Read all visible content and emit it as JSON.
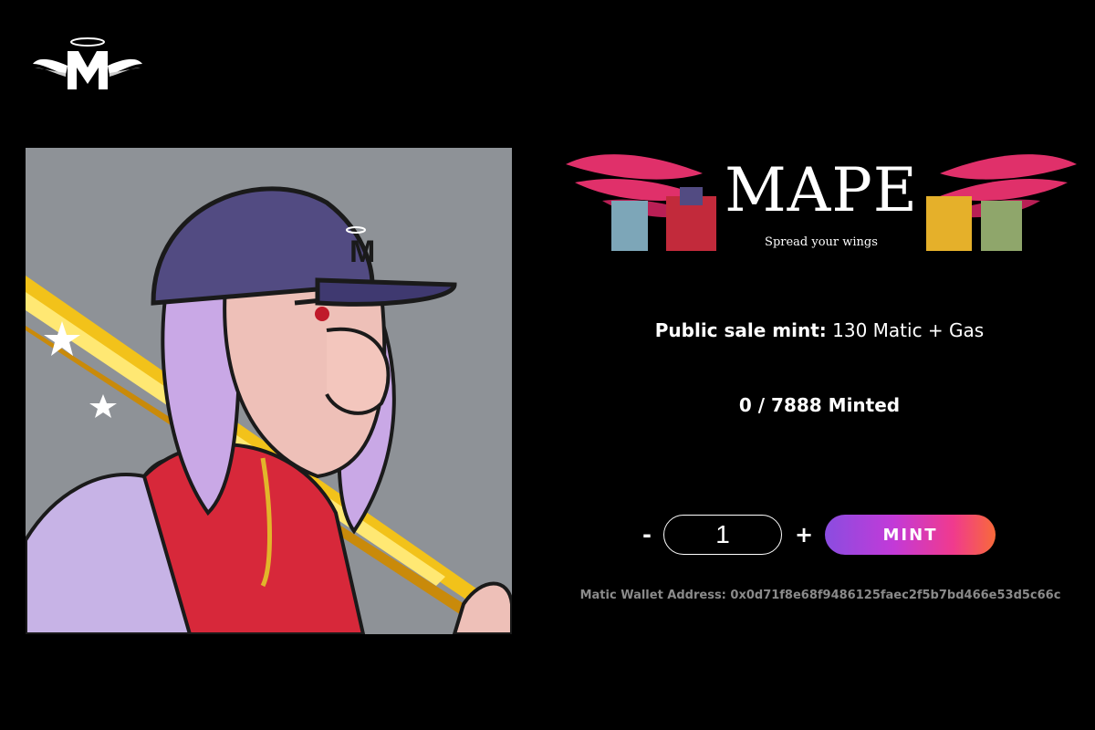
{
  "header": {
    "logo_icon": "winged-m-logo-icon"
  },
  "banner": {
    "title": "MAPE",
    "tagline": "Spread your wings"
  },
  "sale": {
    "label": "Public sale mint:",
    "price": "130 Matic + Gas"
  },
  "supply": {
    "text": "0 / 7888 Minted"
  },
  "mint": {
    "minus_label": "-",
    "quantity": "1",
    "plus_label": "+",
    "button_label": "MINT"
  },
  "wallet": {
    "text": "Matic Wallet Address: 0x0d71f8e68f9486125faec2f5b7bd466e53d5c66c"
  },
  "colors": {
    "background": "#000000",
    "art_background": "#8e9297",
    "gradient_start": "#8a4de0",
    "gradient_end": "#f86a3a",
    "wing_pink": "#e0306a"
  }
}
